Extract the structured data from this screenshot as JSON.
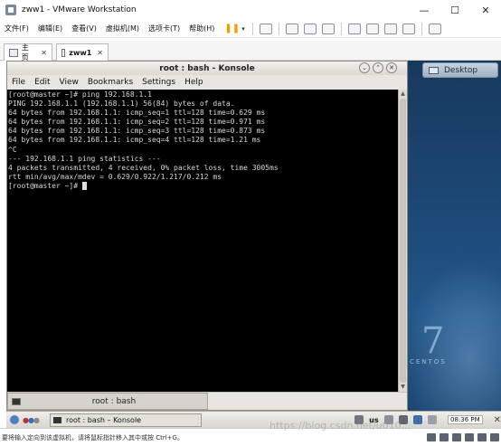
{
  "vm_window": {
    "title": "zww1 - VMware Workstation",
    "controls": {
      "minimize": "—",
      "maximize": "☐",
      "close": "✕"
    },
    "menus": [
      "文件(F)",
      "编辑(E)",
      "查看(V)",
      "虚拟机(M)",
      "选项卡(T)",
      "帮助(H)"
    ],
    "pause_glyph": "❚❚",
    "pause_arrow": "▾",
    "tabs": [
      {
        "label": "主页",
        "close": "✕"
      },
      {
        "label": "zww1",
        "close": "✕"
      }
    ]
  },
  "guest": {
    "desktop_button": "Desktop",
    "centos_version": "7",
    "centos_brand": "CENTOS",
    "konsole": {
      "title": "root : bash - Konsole",
      "title_controls": [
        "⌄",
        "⌃",
        "✕"
      ],
      "menus": [
        "File",
        "Edit",
        "View",
        "Bookmarks",
        "Settings",
        "Help"
      ],
      "lines": [
        "[root@master ~]# ping 192.168.1.1",
        "PING 192.168.1.1 (192.168.1.1) 56(84) bytes of data.",
        "64 bytes from 192.168.1.1: icmp_seq=1 ttl=128 time=0.629 ms",
        "64 bytes from 192.168.1.1: icmp_seq=2 ttl=128 time=0.971 ms",
        "64 bytes from 192.168.1.1: icmp_seq=3 ttl=128 time=0.873 ms",
        "64 bytes from 192.168.1.1: icmp_seq=4 ttl=128 time=1.21 ms",
        "^C",
        "--- 192.168.1.1 ping statistics ---",
        "4 packets transmitted, 4 received, 0% packet loss, time 3005ms",
        "rtt min/avg/max/mdev = 0.629/0.922/1.217/0.212 ms"
      ],
      "prompt": "[root@master ~]# ",
      "scroll_up": "▲",
      "scroll_down": "▼",
      "tab_label": "root : bash"
    },
    "panel": {
      "dots": [
        "●",
        "●",
        "●"
      ],
      "task_label": "root : bash – Konsole",
      "keyboard_layout": "us",
      "clock": "08:36 PM",
      "close": "✕"
    }
  },
  "host_status": {
    "text": "要将输入定向到该虚拟机，请将鼠标指针移入其中或按 Ctrl+G。",
    "watermark": "https://blog.csdn.net/u010..."
  }
}
